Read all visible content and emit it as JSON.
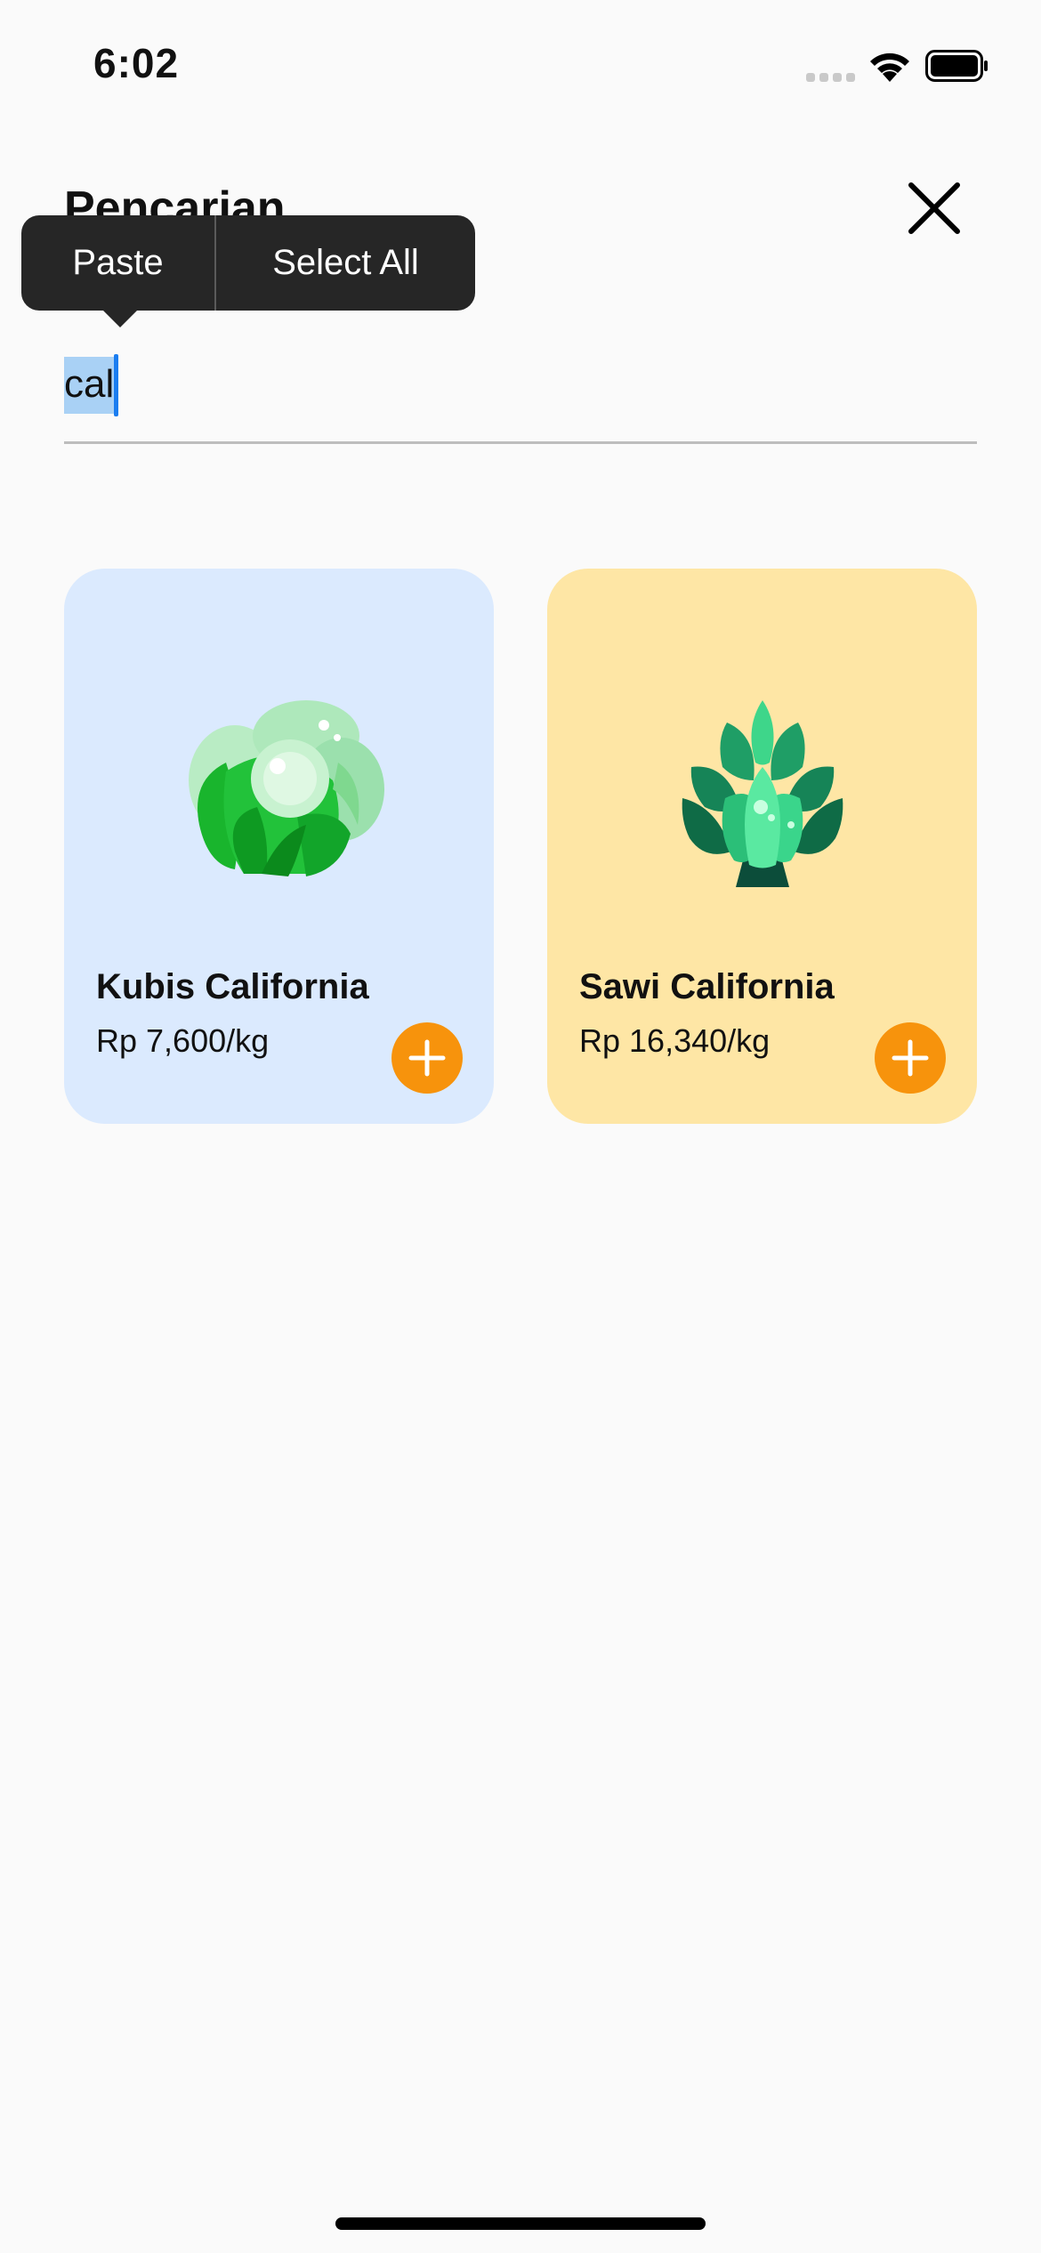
{
  "status_bar": {
    "time": "6:02",
    "icons": [
      "signal-icon",
      "wifi-icon",
      "battery-icon"
    ]
  },
  "header": {
    "title": "Pencarian",
    "close_icon": "close-icon"
  },
  "context_menu": {
    "items": [
      "Paste",
      "Select All"
    ]
  },
  "search": {
    "value": "cal"
  },
  "products": [
    {
      "name": "Kubis California",
      "price": "Rp 7,600/kg",
      "card_color": "#dbeafe",
      "icon": "cabbage-icon"
    },
    {
      "name": "Sawi California",
      "price": "Rp 16,340/kg",
      "card_color": "#fee6a5",
      "icon": "artichoke-icon"
    }
  ],
  "colors": {
    "accent": "#f7930c",
    "selection": "#a9d1f5",
    "caret": "#1a7df0",
    "menu_bg": "#262626"
  }
}
